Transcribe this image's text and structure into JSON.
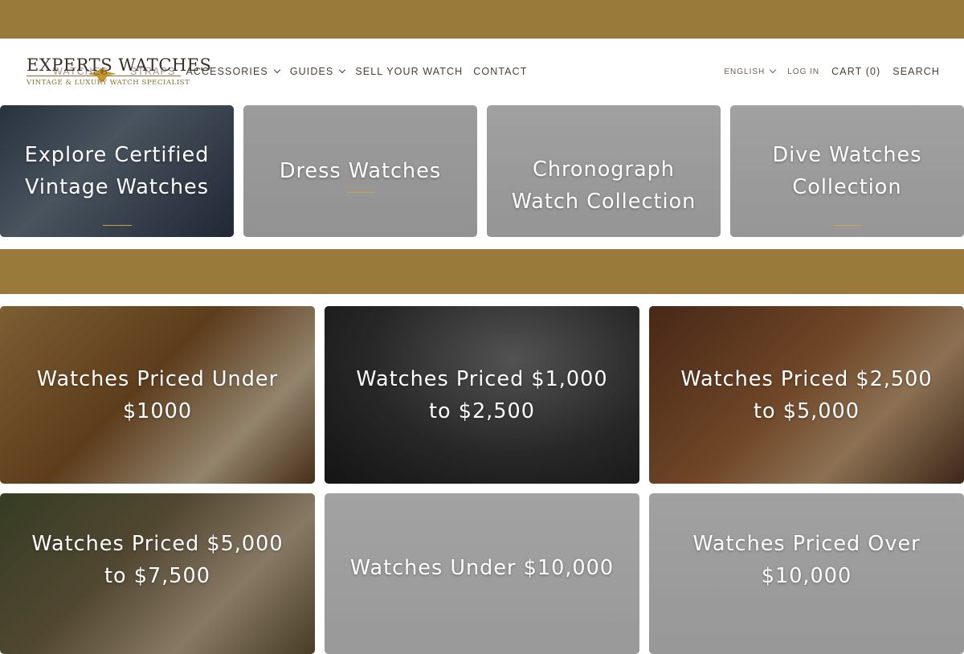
{
  "brand": {
    "name": "Experts Watches",
    "name_display": "EXPERTS WATCHES",
    "tagline": "VINTAGE & LUXURY WATCH SPECIALIST"
  },
  "nav": {
    "left": [
      "WATCHES",
      "STRAPS",
      "ACCESSORIES",
      "GUIDES",
      "SELL YOUR WATCH",
      "CONTACT"
    ],
    "language": "ENGLISH",
    "login": "LOG IN",
    "cart": "CART (0)",
    "search": "SEARCH"
  },
  "categories": [
    {
      "title": "Explore Certified Vintage Watches"
    },
    {
      "title": "Dress Watches"
    },
    {
      "title": "Chronograph Watch Collection"
    },
    {
      "title": "Dive Watches Collection"
    }
  ],
  "price_ranges": [
    {
      "title": "Watches Priced Under $1000"
    },
    {
      "title": "Watches Priced $1,000 to $2,500"
    },
    {
      "title": "Watches Priced $2,500 to $5,000"
    },
    {
      "title": "Watches Priced $5,000 to $7,500"
    },
    {
      "title": "Watches Under $10,000"
    },
    {
      "title": "Watches Priced Over $10,000"
    }
  ],
  "colors": {
    "accent_band": "#9a7a3a",
    "underline": "#c9a24a",
    "text_dark": "#4a3f33"
  }
}
